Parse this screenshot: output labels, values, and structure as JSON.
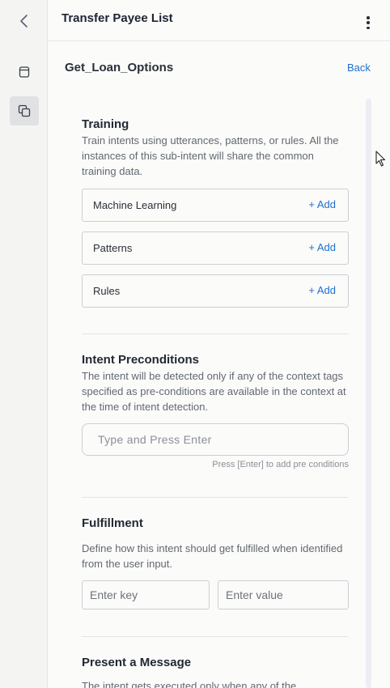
{
  "header": {
    "title": "Transfer Payee List"
  },
  "subheader": {
    "title": "Get_Loan_Options",
    "back_label": "Back"
  },
  "training": {
    "title": "Training",
    "description": "Train intents using utterances, patterns, or rules. All the instances of this sub-intent will share the common training data.",
    "rows": [
      {
        "label": "Machine Learning",
        "action": "+ Add"
      },
      {
        "label": "Patterns",
        "action": "+ Add"
      },
      {
        "label": "Rules",
        "action": "+ Add"
      }
    ]
  },
  "preconditions": {
    "title": "Intent Preconditions",
    "description": "The intent will be detected only if any of the context tags specified as pre-conditions are available in the context at the time of intent detection.",
    "placeholder": "Type and Press Enter",
    "hint": "Press [Enter] to add pre conditions"
  },
  "fulfillment": {
    "title": "Fulfillment",
    "description": "Define how this intent should get fulfilled when identified from the user input.",
    "key_placeholder": "Enter key",
    "value_placeholder": "Enter value"
  },
  "message": {
    "title": "Present a Message",
    "description": "The intent gets executed only when any of the"
  },
  "icons": {
    "back": "chevron-left-icon",
    "rail_1": "document-icon",
    "rail_2": "copy-icon",
    "menu": "kebab-menu-icon"
  },
  "colors": {
    "accent": "#1e6fd1",
    "rail_active": "#dfe1e3"
  }
}
